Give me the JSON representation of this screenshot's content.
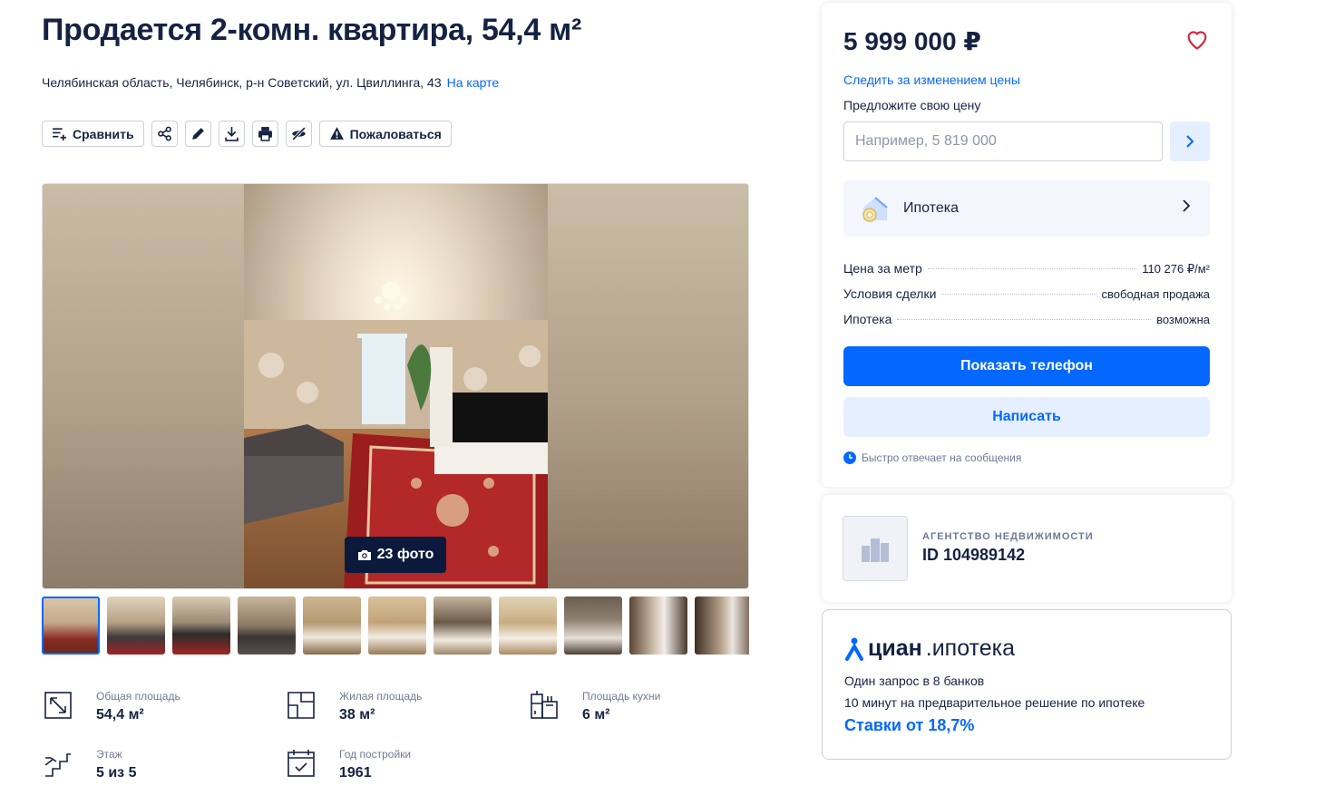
{
  "listing": {
    "title": "Продается 2-комн. квартира, 54,4 м²",
    "address": "Челябинская область, Челябинск, р-н Советский, ул. Цвиллинга, 43",
    "map_link": "На карте"
  },
  "toolbar": {
    "compare_label": "Сравнить",
    "complain_label": "Пожаловаться",
    "icons": [
      "share-icon",
      "edit-icon",
      "download-icon",
      "print-icon",
      "hide-icon",
      "warning-icon"
    ]
  },
  "gallery": {
    "photo_count": "23 фото",
    "thumbnail_count": 11
  },
  "facts": [
    {
      "label": "Общая площадь",
      "value": "54,4 м²",
      "icon": "area-icon"
    },
    {
      "label": "Жилая площадь",
      "value": "38 м²",
      "icon": "floorplan-icon"
    },
    {
      "label": "Площадь кухни",
      "value": "6 м²",
      "icon": "kitchen-icon"
    },
    {
      "label": "Этаж",
      "value": "5 из 5",
      "icon": "stairs-icon"
    },
    {
      "label": "Год постройки",
      "value": "1961",
      "icon": "calendar-icon"
    }
  ],
  "price_card": {
    "price": "5 999 000 ₽",
    "follow_price": "Следить за изменением цены",
    "offer_label": "Предложите свою цену",
    "offer_placeholder": "Например, 5 819 000",
    "mortgage_label": "Ипотека",
    "details": [
      {
        "label": "Цена за метр",
        "value": "110 276 ₽/м²"
      },
      {
        "label": "Условия сделки",
        "value": "свободная продажа"
      },
      {
        "label": "Ипотека",
        "value": "возможна"
      }
    ],
    "show_phone": "Показать телефон",
    "write": "Написать",
    "fast_reply": "Быстро отвечает на сообщения"
  },
  "agency": {
    "type": "АГЕНТСТВО НЕДВИЖИМОСТИ",
    "id": "ID 104989142"
  },
  "cian_mortgage": {
    "brand": "циан",
    "brand_suffix": ".ипотека",
    "line1": "Один запрос в 8 банков",
    "line2": "10 минут на предварительное решение по ипотеке",
    "rate": "Ставки от 18,7%"
  },
  "colors": {
    "accent": "#0468ff",
    "text": "#152242",
    "muted": "#707a95",
    "heart": "#d6213b"
  }
}
